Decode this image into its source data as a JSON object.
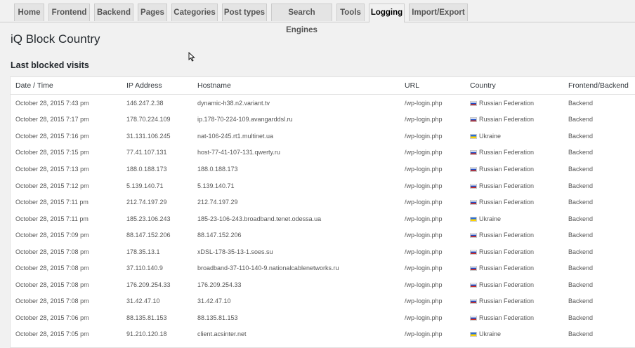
{
  "tabs": [
    {
      "label": "Home",
      "active": false
    },
    {
      "label": "Frontend",
      "active": false
    },
    {
      "label": "Backend",
      "active": false
    },
    {
      "label": "Pages",
      "active": false
    },
    {
      "label": "Categories",
      "active": false
    },
    {
      "label": "Post types",
      "active": false
    },
    {
      "label": "Search Engines",
      "active": false
    },
    {
      "label": "Tools",
      "active": false
    },
    {
      "label": "Logging",
      "active": true
    },
    {
      "label": "Import/Export",
      "active": false
    }
  ],
  "page_title": "iQ Block Country",
  "section_title": "Last blocked visits",
  "table": {
    "columns": [
      "Date / Time",
      "IP Address",
      "Hostname",
      "URL",
      "Country",
      "Frontend/Backend"
    ],
    "rows": [
      {
        "datetime": "October 28, 2015 7:43 pm",
        "ip": "146.247.2.38",
        "hostname": "dynamic-h38.n2.variant.tv",
        "url": "/wp-login.php",
        "country": "Russian Federation",
        "flag": "ru",
        "side": "Backend"
      },
      {
        "datetime": "October 28, 2015 7:17 pm",
        "ip": "178.70.224.109",
        "hostname": "ip.178-70-224-109.avangarddsl.ru",
        "url": "/wp-login.php",
        "country": "Russian Federation",
        "flag": "ru",
        "side": "Backend"
      },
      {
        "datetime": "October 28, 2015 7:16 pm",
        "ip": "31.131.106.245",
        "hostname": "nat-106-245.rt1.multinet.ua",
        "url": "/wp-login.php",
        "country": "Ukraine",
        "flag": "ua",
        "side": "Backend"
      },
      {
        "datetime": "October 28, 2015 7:15 pm",
        "ip": "77.41.107.131",
        "hostname": "host-77-41-107-131.qwerty.ru",
        "url": "/wp-login.php",
        "country": "Russian Federation",
        "flag": "ru",
        "side": "Backend"
      },
      {
        "datetime": "October 28, 2015 7:13 pm",
        "ip": "188.0.188.173",
        "hostname": "188.0.188.173",
        "url": "/wp-login.php",
        "country": "Russian Federation",
        "flag": "ru",
        "side": "Backend"
      },
      {
        "datetime": "October 28, 2015 7:12 pm",
        "ip": "5.139.140.71",
        "hostname": "5.139.140.71",
        "url": "/wp-login.php",
        "country": "Russian Federation",
        "flag": "ru",
        "side": "Backend"
      },
      {
        "datetime": "October 28, 2015 7:11 pm",
        "ip": "212.74.197.29",
        "hostname": "212.74.197.29",
        "url": "/wp-login.php",
        "country": "Russian Federation",
        "flag": "ru",
        "side": "Backend"
      },
      {
        "datetime": "October 28, 2015 7:11 pm",
        "ip": "185.23.106.243",
        "hostname": "185-23-106-243.broadband.tenet.odessa.ua",
        "url": "/wp-login.php",
        "country": "Ukraine",
        "flag": "ua",
        "side": "Backend"
      },
      {
        "datetime": "October 28, 2015 7:09 pm",
        "ip": "88.147.152.206",
        "hostname": "88.147.152.206",
        "url": "/wp-login.php",
        "country": "Russian Federation",
        "flag": "ru",
        "side": "Backend"
      },
      {
        "datetime": "October 28, 2015 7:08 pm",
        "ip": "178.35.13.1",
        "hostname": "xDSL-178-35-13-1.soes.su",
        "url": "/wp-login.php",
        "country": "Russian Federation",
        "flag": "ru",
        "side": "Backend"
      },
      {
        "datetime": "October 28, 2015 7:08 pm",
        "ip": "37.110.140.9",
        "hostname": "broadband-37-110-140-9.nationalcablenetworks.ru",
        "url": "/wp-login.php",
        "country": "Russian Federation",
        "flag": "ru",
        "side": "Backend"
      },
      {
        "datetime": "October 28, 2015 7:08 pm",
        "ip": "176.209.254.33",
        "hostname": "176.209.254.33",
        "url": "/wp-login.php",
        "country": "Russian Federation",
        "flag": "ru",
        "side": "Backend"
      },
      {
        "datetime": "October 28, 2015 7:08 pm",
        "ip": "31.42.47.10",
        "hostname": "31.42.47.10",
        "url": "/wp-login.php",
        "country": "Russian Federation",
        "flag": "ru",
        "side": "Backend"
      },
      {
        "datetime": "October 28, 2015 7:06 pm",
        "ip": "88.135.81.153",
        "hostname": "88.135.81.153",
        "url": "/wp-login.php",
        "country": "Russian Federation",
        "flag": "ru",
        "side": "Backend"
      },
      {
        "datetime": "October 28, 2015 7:05 pm",
        "ip": "91.210.120.18",
        "hostname": "client.acsinter.net",
        "url": "/wp-login.php",
        "country": "Ukraine",
        "flag": "ua",
        "side": "Backend"
      }
    ]
  }
}
